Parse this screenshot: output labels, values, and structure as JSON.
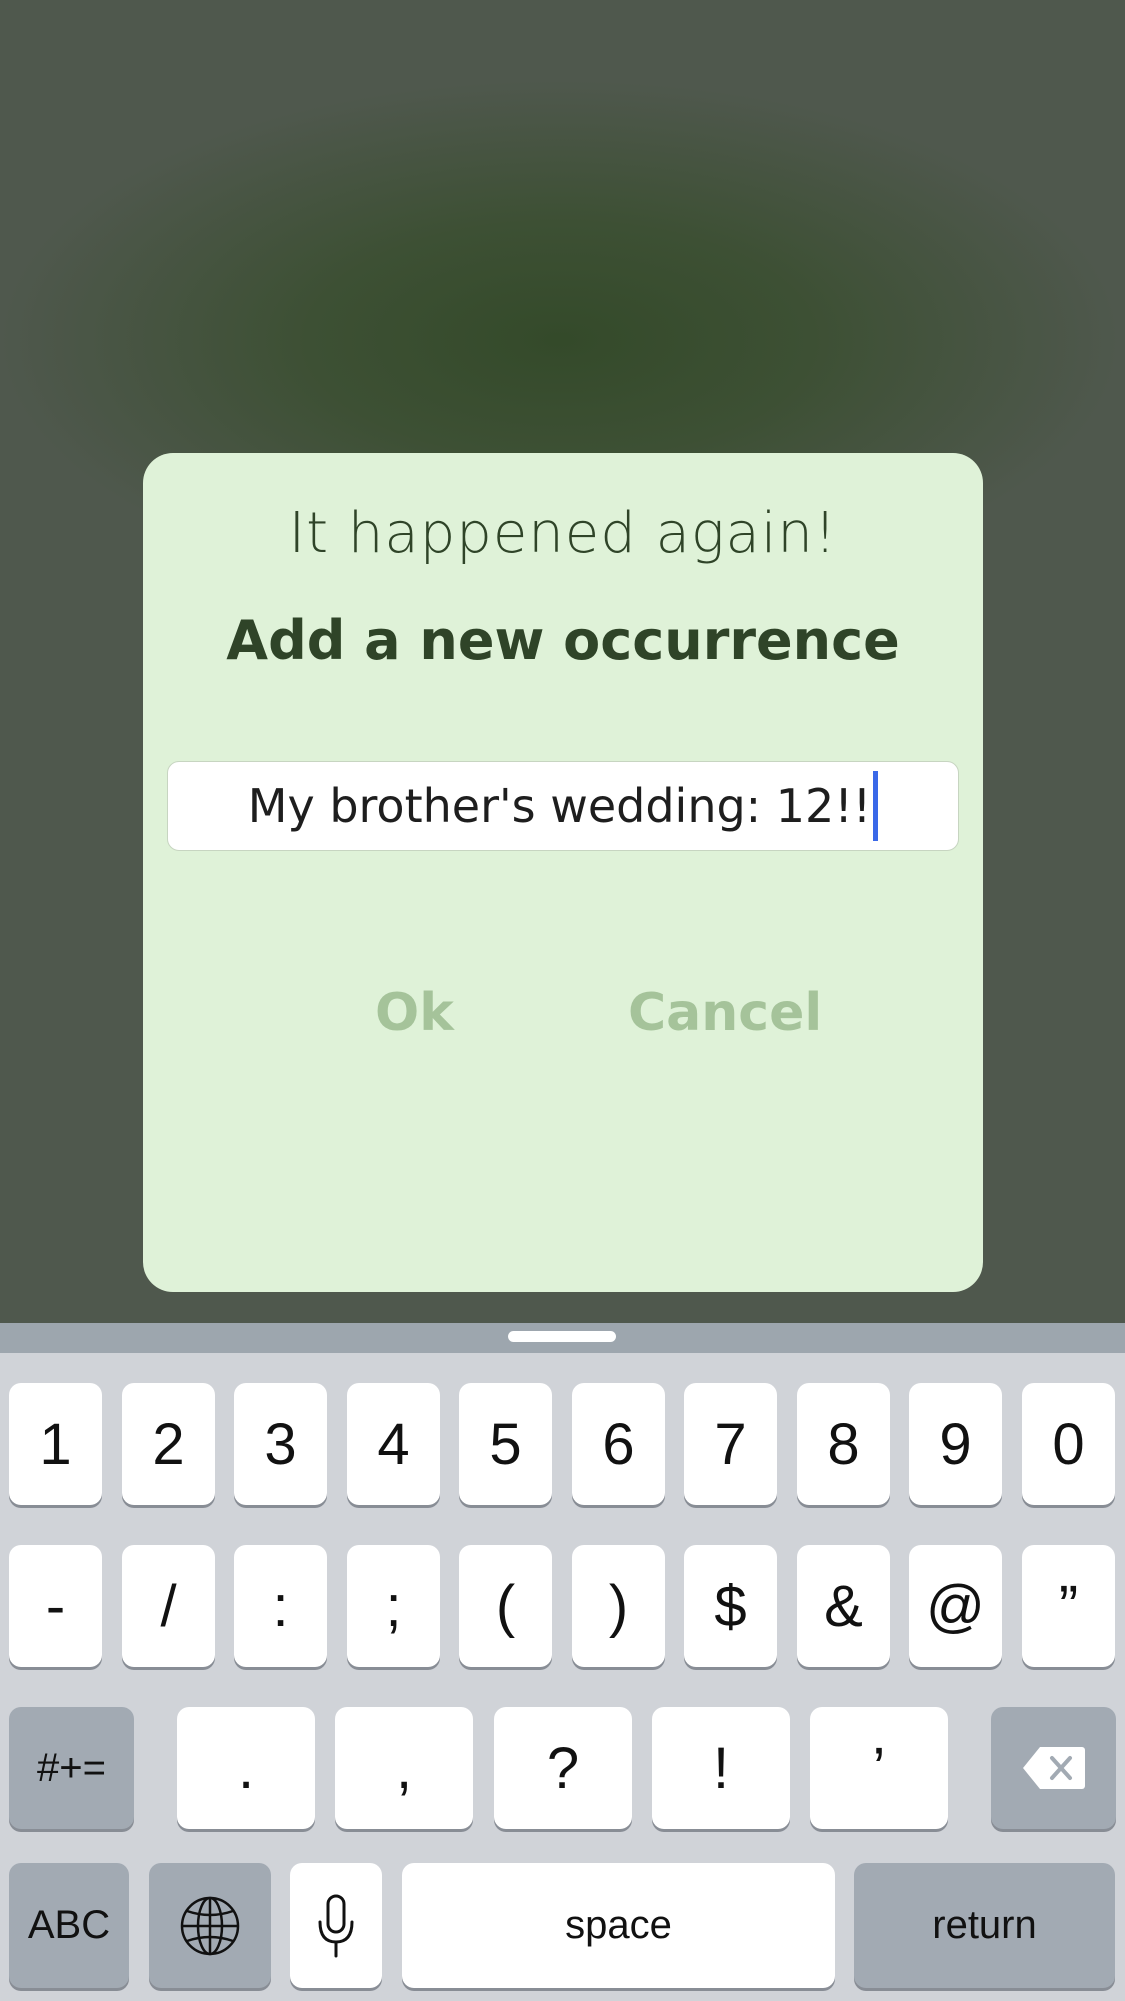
{
  "dialog": {
    "title": "It happened again!",
    "subtitle": "Add a new occurrence",
    "input_value": "My brother's wedding: 12!!",
    "ok_label": "Ok",
    "cancel_label": "Cancel"
  },
  "keyboard": {
    "row1": [
      "1",
      "2",
      "3",
      "4",
      "5",
      "6",
      "7",
      "8",
      "9",
      "0"
    ],
    "row2": [
      "-",
      "/",
      ":",
      ";",
      "(",
      ")",
      "$",
      "&",
      "@",
      "”"
    ],
    "row3": {
      "shift_label": "#+=",
      "keys": [
        ".",
        ",",
        "?",
        "!",
        "’"
      ],
      "delete_icon": "backspace-icon"
    },
    "row4": {
      "abc_label": "ABC",
      "globe_icon": "globe-icon",
      "mic_icon": "microphone-icon",
      "space_label": "space",
      "return_label": "return"
    }
  },
  "colors": {
    "dialog_bg": "#dff2d8",
    "title_text": "#2f4428",
    "button_text": "#a5c39a",
    "caret": "#3a68e8"
  }
}
